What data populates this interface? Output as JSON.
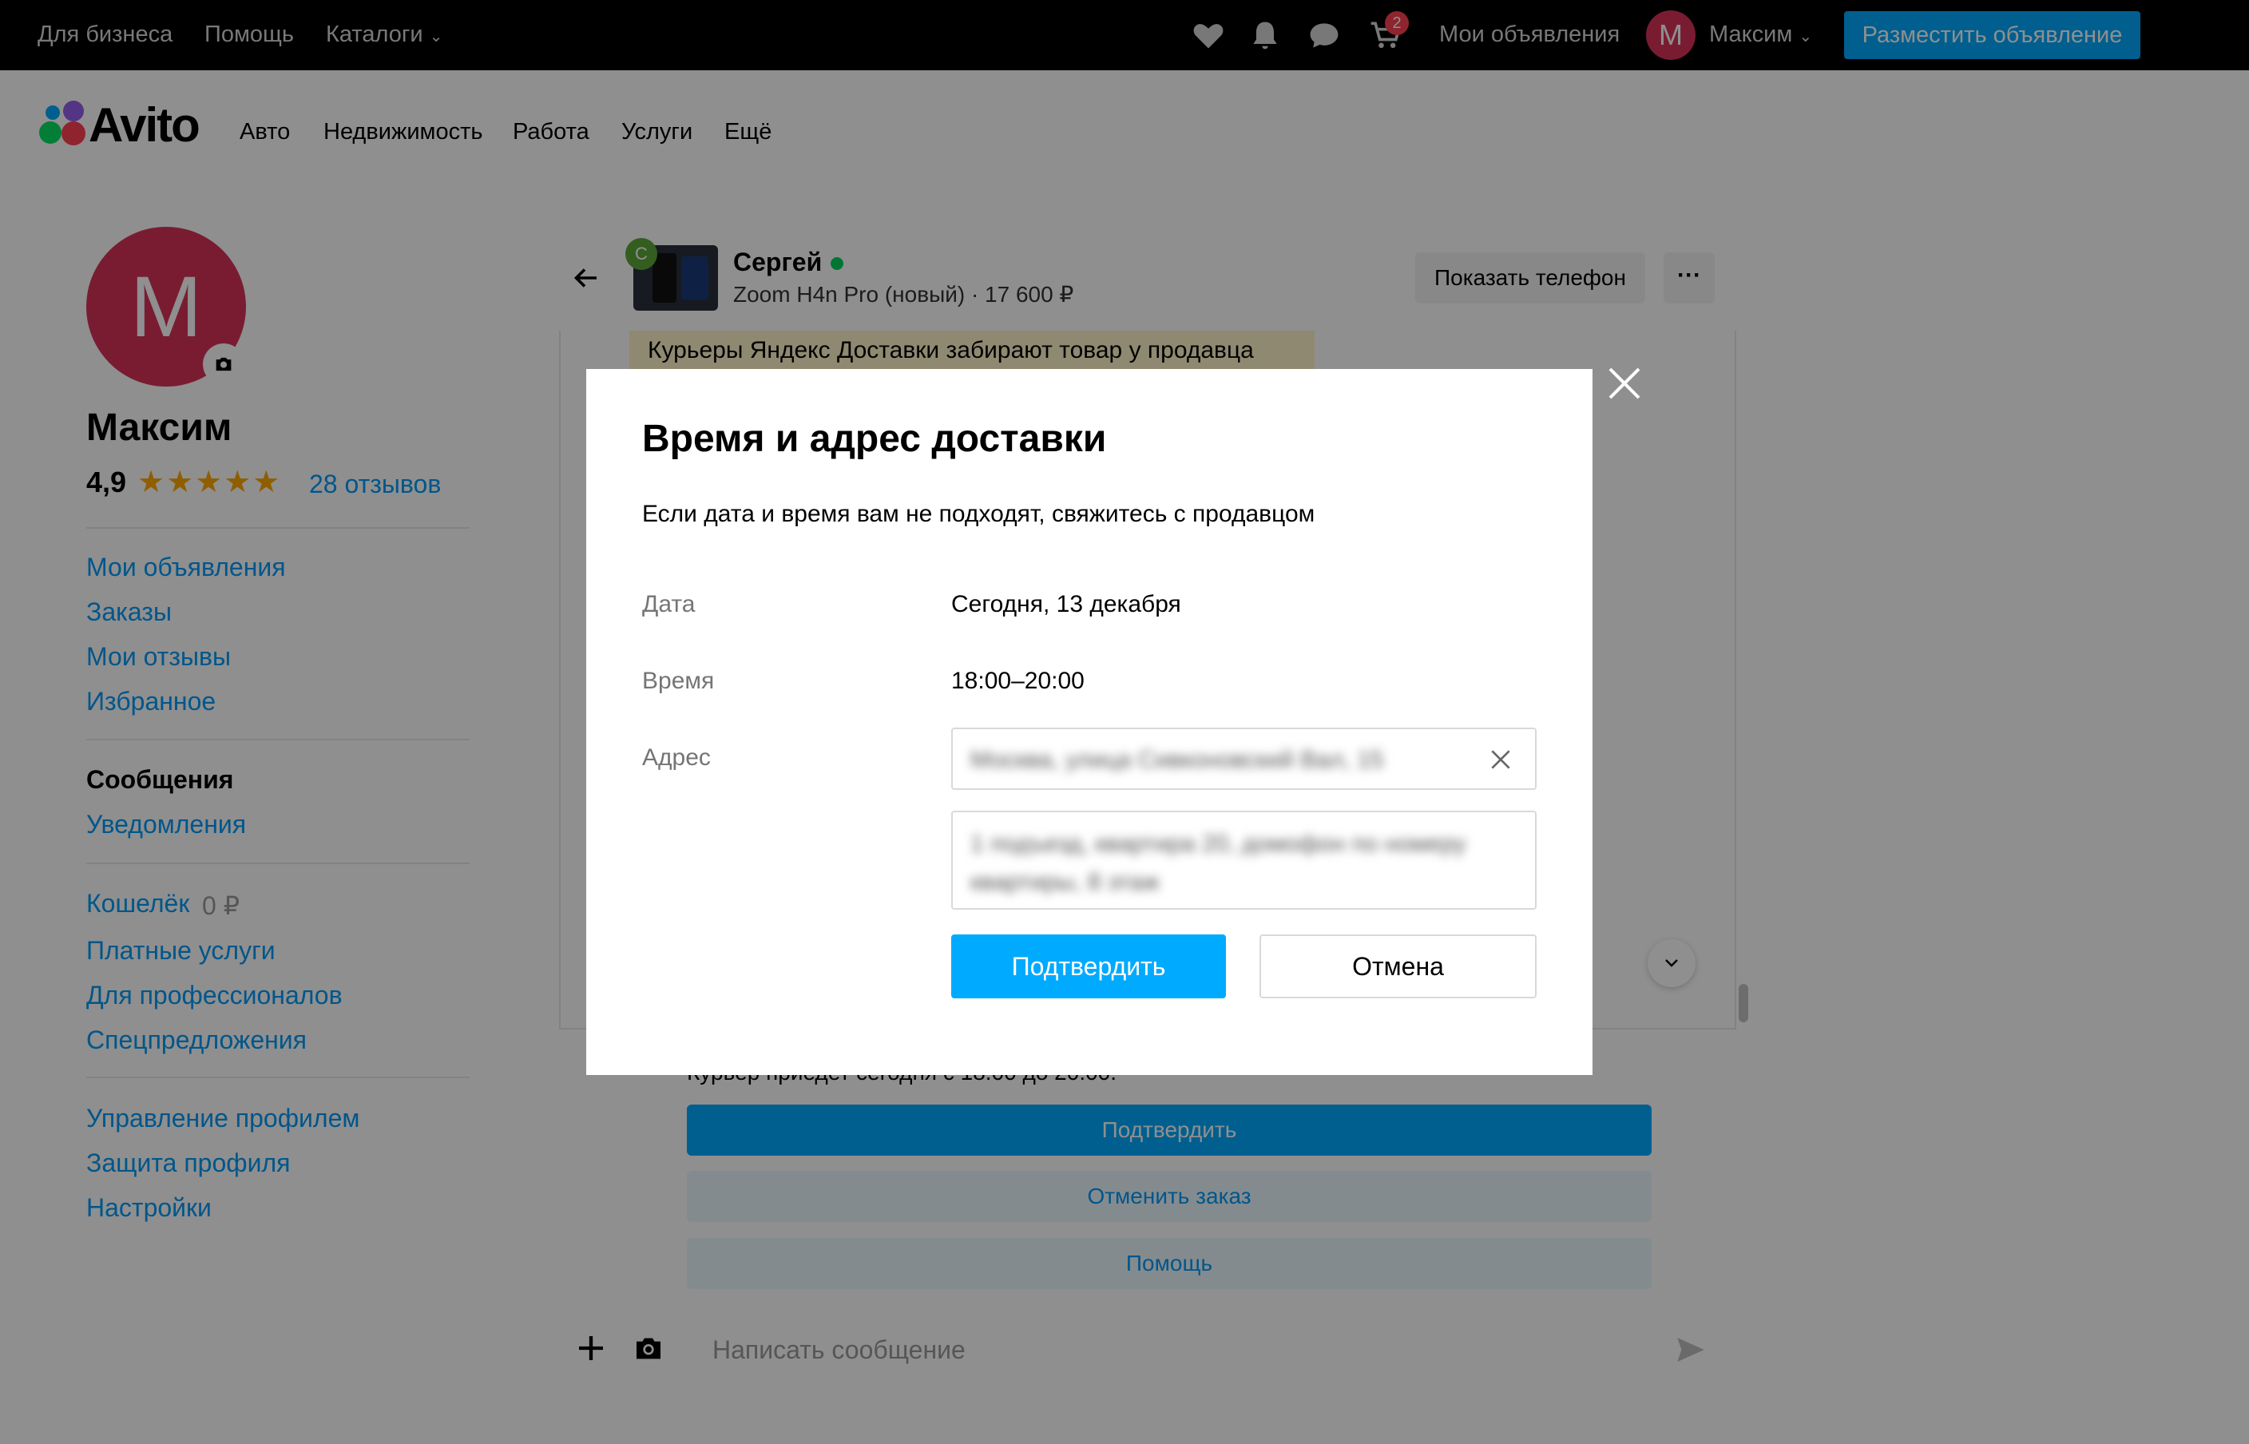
{
  "topbar": {
    "for_business": "Для бизнеса",
    "help": "Помощь",
    "catalogs": "Каталоги",
    "cart_count": "2",
    "my_ads": "Мои объявления",
    "avatar_letter": "M",
    "username": "Максим",
    "post_ad": "Разместить объявление"
  },
  "logo": {
    "text": "Avito"
  },
  "nav": [
    "Авто",
    "Недвижимость",
    "Работа",
    "Услуги",
    "Ещё"
  ],
  "profile": {
    "avatar_letter": "M",
    "name": "Максим",
    "rating": "4,9",
    "stars": "★★★★★",
    "reviews": "28 отзывов"
  },
  "sidebar": {
    "my_ads": "Мои объявления",
    "orders": "Заказы",
    "my_reviews": "Мои отзывы",
    "favorites": "Избранное",
    "messages": "Сообщения",
    "notifications": "Уведомления",
    "wallet": "Кошелёк",
    "wallet_value": "0 ₽",
    "paid_services": "Платные услуги",
    "for_pros": "Для профессионалов",
    "special_offers": "Спецпредложения",
    "profile_mgmt": "Управление профилем",
    "profile_protect": "Защита профиля",
    "settings": "Настройки"
  },
  "chat": {
    "avatar_letter": "С",
    "name": "Сергей",
    "subtitle": "Zoom H4n Pro (новый) · 17 600 ₽",
    "show_phone": "Показать телефон",
    "more": "···",
    "courier_note": "Курьеры Яндекс Доставки забирают товар у продавца",
    "courier_text": "Курьер приедет сегодня с 18:00 до 20:00.",
    "confirm": "Подтвердить",
    "cancel_order": "Отменить заказ",
    "help": "Помощь",
    "input_placeholder": "Написать сообщение"
  },
  "modal": {
    "title": "Время и адрес доставки",
    "subtitle": "Если дата и время вам не подходят, свяжитесь с продавцом",
    "date_label": "Дата",
    "date_value": "Сегодня, 13 декабря",
    "time_label": "Время",
    "time_value": "18:00–20:00",
    "address_label": "Адрес",
    "address_value": "Москва, улица Сивконовский Вал, 15",
    "address_extra": "1 подъезд, квартира 20, домофон по номеру квартиры, 8 этаж",
    "confirm": "Подтвердить",
    "cancel": "Отмена"
  }
}
